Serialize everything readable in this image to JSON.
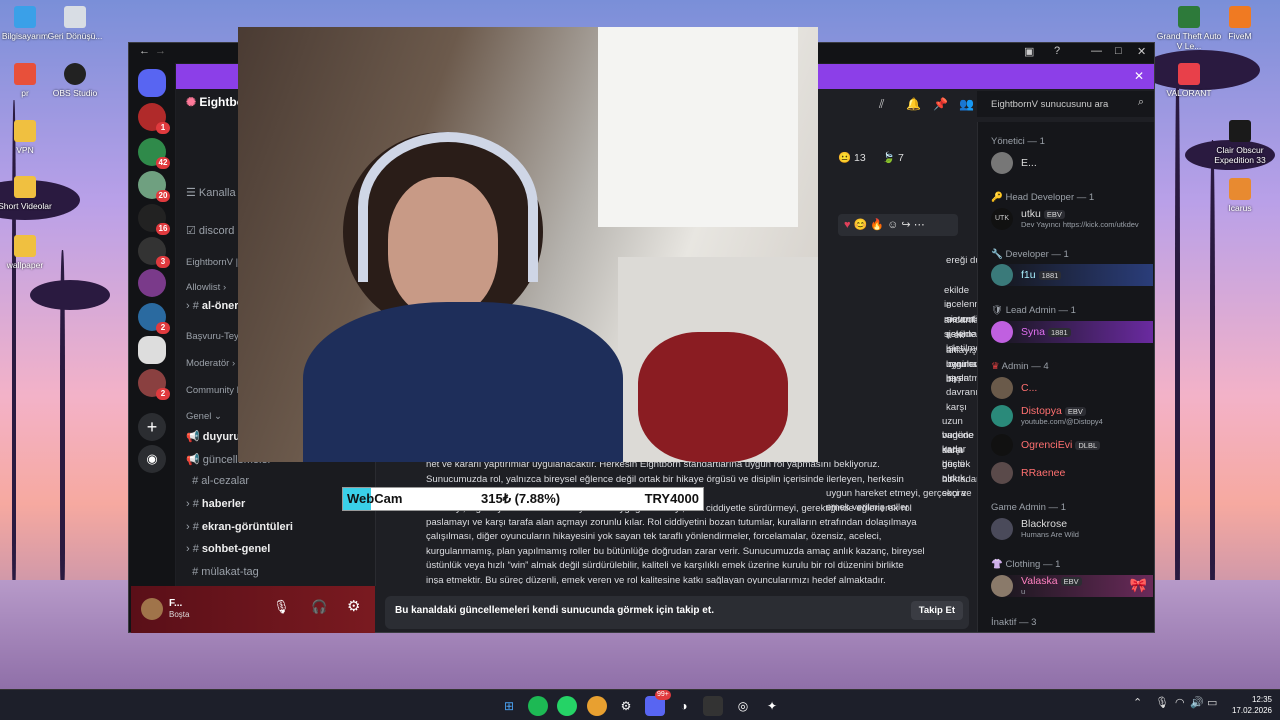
{
  "desktop": {
    "left_icons": [
      "Bilgisayarım",
      "Geri Dönüşü...",
      "pr",
      "OBS Studio",
      "VPN",
      "Short Videolar",
      "wallpaper"
    ],
    "right_icons": [
      "Grand Theft Auto V Le...",
      "FiveM",
      "VALORANT",
      "Clair Obscur Expedition 33",
      "Icarus"
    ]
  },
  "discord": {
    "server_badges": [
      "1",
      "42",
      "20",
      "16",
      "3",
      "2",
      "2"
    ],
    "server_name": "Eightbo",
    "channels": {
      "kanallar": "Kanalla",
      "discord": "discord",
      "eightbornv": "EightbornV |",
      "allowlist": "Allowlist",
      "al_oneri": "al-öner",
      "basvuru": "Başvuru-Teyi",
      "moderator": "Moderatör",
      "community": "Community F",
      "genel": "Genel",
      "duyurular": "duyurul",
      "guncellemeler": "güncellemeler",
      "al_cezalar": "al-cezalar",
      "haberler": "haberler",
      "ekran": "ekran-görüntüleri",
      "sohbet": "sohbet-genel",
      "mulakat": "mülakat-tag"
    },
    "user": {
      "name": "F...",
      "status": "Boşta"
    },
    "search_placeholder": "EightbornV sunucusunu ara",
    "reactions": [
      "13",
      "7"
    ],
    "chat_lines": [
      "ereği duyduk.",
      "ekilde incelenmiş mevcut",
      "e sistemli şekilde işletilmeye",
      "andartlarına sistematik",
      "a ek bir uygulama başlatma",
      "anlayışını benimseyen bir",
      "oyuncuların",
      "leyen davranışlara karşı",
      "uzun vadede daha güçlü bir",
      "bugüne kadar destek olduk,",
      "karşı bu noktadan sonra",
      "net ve kararlı yaptırımlar uygulanacaktır. Herkesin Eightborn standartlarına uygun rol yapmasını bekliyoruz.",
      "Sunucumuzda rol, yalnızca bireysel eğlence değil ortak bir hikaye örgüsü ve disiplin içerisinde ilerleyen, herkesin",
      "uygun hareket etmeyi, gerçekçi ve emek verilmiş roller",
      "üretmeyi, diğer oyuncuların rol deneyimine saygı göstermeyi, rolü ciddiyetle sürdürmeyi, gerektiğinde eğlenerek rol",
      "paslamayı ve karşı tarafa alan açmayı zorunlu kılar. Rol ciddiyetini bozan tutumlar, kuralların etrafından dolaşılmaya",
      "çalışılması, diğer oyuncuların hikayesini yok sayan tek taraflı yönlendirmeler, forcelamalar, özensiz, aceleci,",
      "kurgulanmamış, plan yapılmamış roller bu bütünlüğe doğrudan zarar verir. Sunucumuzda amaç anlık kazanç, bireysel",
      "üstünlük veya hızlı “win” almak değil sürdürülebilir, kaliteli ve karşılıklı emek üzerine kurulu bir rol düzenini birlikte",
      "inşa etmektir. Bu süreç düzenli, emek veren ve rol kalitesine katkı sağlayan oyuncularımızı hedef almaktadır."
    ],
    "follow_text": "Bu kanaldaki güncellemeleri kendi sunucunda görmek için takip et.",
    "follow_button": "Takip Et",
    "members": {
      "yonetici": "Yönetici — 1",
      "yonetici_name": "E...",
      "head_dev": "Head Developer — 1",
      "utku": "utku",
      "utku_tag": "EBV",
      "utku_status": "Dev Yayıncı https://kick.com/utkdev",
      "utku_avatar": "UTK",
      "developer": "Developer — 1",
      "flu": "f1u",
      "flu_tag": "1881",
      "lead_admin": "Lead Admin — 1",
      "syna": "Syna",
      "syna_tag": "1881",
      "admin": "Admin — 4",
      "admin1": "C...",
      "distopya": "Distopya",
      "distopya_tag": "EBV",
      "distopya_status": "youtube.com/@Distopy4",
      "ogrenci": "OgrenciEvi",
      "ogrenci_tag": "DLBL",
      "rraenee": "RRaenee",
      "game_admin": "Game Admin — 1",
      "blackrose": "Blackrose",
      "blackrose_status": "Humans Are Wild",
      "clothing": "Clothing — 1",
      "valaska": "Valaska",
      "valaska_tag": "EBV",
      "valaska_status": "u",
      "inaktif": "İnaktif — 3"
    }
  },
  "overlay": {
    "label": "WebCam",
    "value": "315₺ (7.88%)",
    "goal": "TRY4000",
    "progress": 0.0788
  },
  "taskbar": {
    "time": "12:35",
    "date": "17.02.2026",
    "badge": "99+"
  }
}
